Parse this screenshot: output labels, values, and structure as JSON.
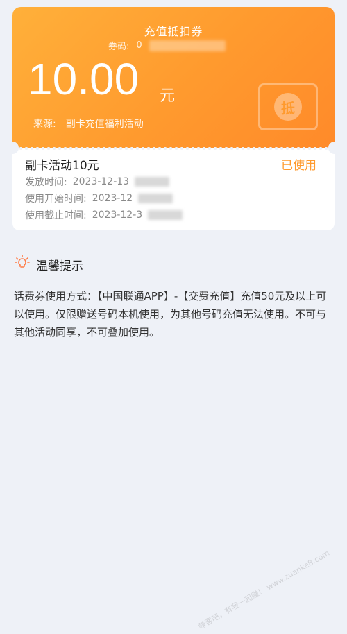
{
  "coupon": {
    "title": "充值抵扣券",
    "code_label": "券码:",
    "code_value": "0",
    "amount": "10.00",
    "unit": "元",
    "source_label": "来源:",
    "source_value": "副卡充值福利活动",
    "stamp_char": "抵"
  },
  "card": {
    "name": "副卡活动10元",
    "status": "已使用",
    "issue_label": "发放时间:",
    "issue_value": "2023-12-13",
    "start_label": "使用开始时间:",
    "start_value": "2023-12",
    "end_label": "使用截止时间:",
    "end_value": "2023-12-3"
  },
  "tips": {
    "title": "温馨提示",
    "text": "话费券使用方式：【中国联通APP】-【交费充值】充值50元及以上可以使用。仅限赠送号码本机使用，为其他号码充值无法使用。不可与其他活动同享，不可叠加使用。"
  },
  "watermark": "赚客吧，有我一起赚！ www.zuanke8.com",
  "colors": {
    "accent": "#ff9a2e",
    "background": "#eef1f7"
  }
}
